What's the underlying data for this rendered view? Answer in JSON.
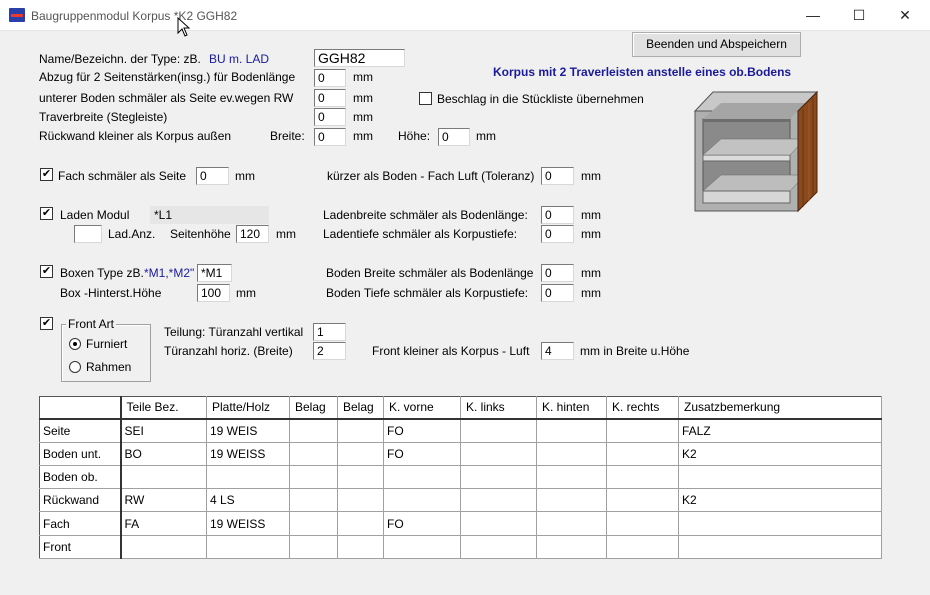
{
  "window": {
    "title": "Baugruppenmodul   Korpus   *K2   GGH82",
    "controls": {
      "minimize": "—",
      "maximize": "☐",
      "close": "✕"
    }
  },
  "header": {
    "save_button": "Beenden und Abspeichern",
    "right_heading": "Korpus mit 2 Traverleisten anstelle eines ob.Bodens"
  },
  "form": {
    "name_label": "Name/Bezeichn. der Type: zB.",
    "name_example": "BU m. LAD",
    "name_value": "GGH82",
    "abzug_label": "Abzug für 2 Seitenstärken(insg.) für Bodenlänge",
    "abzug_value": "0",
    "unterer_label": "unterer Boden schmäler als Seite   ev.wegen RW",
    "unterer_value": "0",
    "traver_label": "Traverbreite (Stegleiste)",
    "traver_value": "0",
    "rueck_label": "Rückwand kleiner als Korpus außen",
    "breite_label": "Breite:",
    "breite_value": "0",
    "hoehe_label": "Höhe:",
    "hoehe_value": "0",
    "mm": "mm",
    "beschlag_label": "Beschlag in die Stückliste übernehmen",
    "fach_label": "Fach schmäler als Seite",
    "fach_value": "0",
    "kuerzer_label": "kürzer als Boden - Fach Luft (Toleranz)",
    "kuerzer_value": "0",
    "laden_label": "Laden Modul",
    "laden_value": "*L1",
    "ladanz_value": "",
    "ladanz_label": "Lad.Anz.",
    "seitenhoehe_label": "Seitenhöhe",
    "seitenhoehe_value": "120",
    "ladenbreite_label": "Ladenbreite schmäler als Bodenlänge:",
    "ladenbreite_value": "0",
    "ladentiefe_label": "Ladentiefe schmäler als Korpustiefe:",
    "ladentiefe_value": "0",
    "boxen_label": "Boxen Type zB.",
    "boxen_example": "*M1,*M2\"",
    "boxen_value": "*M1",
    "boxhoehe_label": "Box -Hinterst.Höhe",
    "boxhoehe_value": "100",
    "bodenbreite_label": "Boden Breite schmäler als Bodenlänge",
    "bodenbreite_value": "0",
    "bodentiefe_label": "Boden Tiefe schmäler als Korpustiefe:",
    "bodentiefe_value": "0",
    "frontart_label": "Front Art",
    "furniert_label": "Furniert",
    "rahmen_label": "Rahmen",
    "tuer_vert_label": "Teilung: Türanzahl vertikal",
    "tuer_vert_value": "1",
    "tuer_horiz_label": "Türanzahl horiz. (Breite)",
    "tuer_horiz_value": "2",
    "front_luft_label": "Front  kleiner als Korpus - Luft",
    "front_luft_value": "4",
    "front_luft_unit": "mm in Breite u.Höhe",
    "checkmark": "✔"
  },
  "table": {
    "headers": [
      "Teile Bez.",
      "Platte/Holz",
      "Belag",
      "Belag",
      "K. vorne",
      "K. links",
      "K. hinten",
      "K. rechts",
      "Zusatzbemerkung"
    ],
    "rows": [
      {
        "label": "Seite",
        "cells": [
          "SEI",
          "19 WEIS",
          "",
          "",
          "FO",
          "",
          "",
          "",
          "FALZ"
        ]
      },
      {
        "label": "Boden unt.",
        "cells": [
          "BO",
          "19 WEISS",
          "",
          "",
          "FO",
          "",
          "",
          "",
          "K2"
        ]
      },
      {
        "label": "Boden ob.",
        "cells": [
          "",
          "",
          "",
          "",
          "",
          "",
          "",
          "",
          ""
        ]
      },
      {
        "label": "Rückwand",
        "cells": [
          "RW",
          "4 LS",
          "",
          "",
          "",
          "",
          "",
          "",
          "K2"
        ]
      },
      {
        "label": "Fach",
        "cells": [
          "FA",
          "19 WEISS",
          "",
          "",
          "FO",
          "",
          "",
          "",
          ""
        ]
      },
      {
        "label": "Front",
        "cells": [
          "",
          "",
          "",
          "",
          "",
          "",
          "",
          "",
          ""
        ]
      }
    ]
  }
}
